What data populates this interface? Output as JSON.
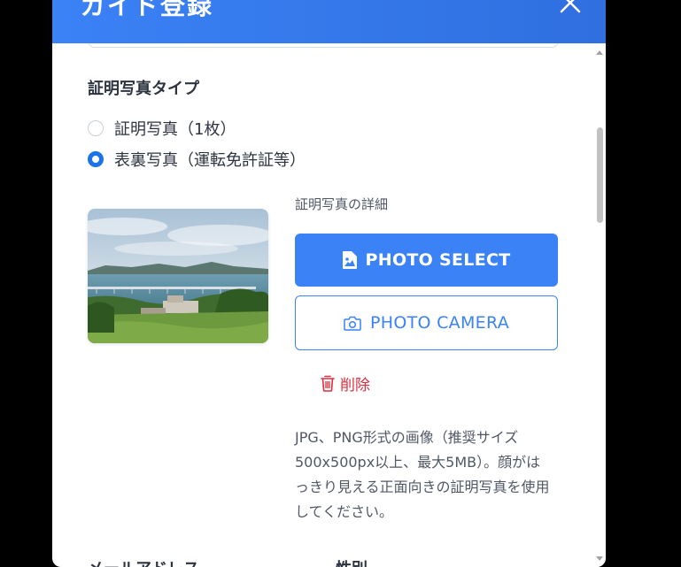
{
  "modal": {
    "title": "ガイド登録",
    "close_icon": "close-icon"
  },
  "photo_type": {
    "section_title": "証明写真タイプ",
    "options": [
      {
        "label": "証明写真（1枚）",
        "checked": false
      },
      {
        "label": "表裏写真（運転免許証等）",
        "checked": true
      }
    ]
  },
  "photo_details": {
    "label": "証明写真の詳細",
    "select_button": {
      "label": "PHOTO SELECT",
      "icon": "image-file-icon"
    },
    "camera_button": {
      "label": "PHOTO CAMERA",
      "icon": "camera-icon"
    },
    "delete_button": {
      "label": "削除",
      "icon": "trash-icon"
    },
    "help_text": "JPG、PNG形式の画像（推奨サイズ500x500px以上、最大5MB）。顔がはっきり見える正面向きの証明写真を使用してください。"
  },
  "next_section": {
    "email_label": "メールアドレス",
    "gender_label": "性別"
  },
  "colors": {
    "header": "#3b82f6",
    "primary": "#3b82f6",
    "danger": "#dc2f3f",
    "text": "#2d3440"
  }
}
